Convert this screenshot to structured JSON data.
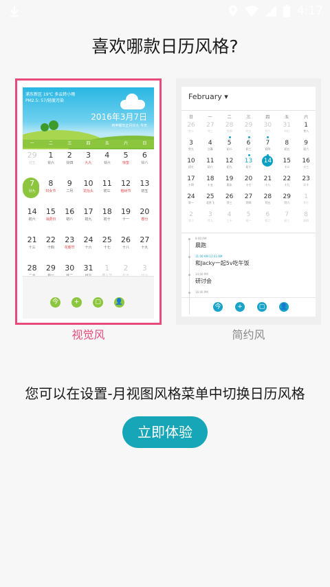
{
  "status_bar": {
    "time": "4:17"
  },
  "title": "喜欢哪款日历风格?",
  "visual_preview": {
    "weather_line1": "浦东新区 19℃ 多云转小雨",
    "weather_line2": "PM2.5: 57/轻度污染",
    "date": "2016年3月7日",
    "sub": "丙申猴年正月廿九 今天",
    "weekdays": [
      "一",
      "二",
      "三",
      "四",
      "五",
      "六",
      "日"
    ],
    "rows": [
      [
        {
          "n": "29",
          "l": "廿五",
          "dim": true
        },
        {
          "n": "1",
          "l": "廿六"
        },
        {
          "n": "2",
          "l": "廿四"
        },
        {
          "n": "3",
          "l": "九九",
          "red": true
        },
        {
          "n": "4",
          "l": "廿六"
        },
        {
          "n": "5",
          "l": "惊蛰",
          "red": true
        },
        {
          "n": "6",
          "l": "廿八"
        }
      ],
      [
        {
          "n": "7",
          "l": "廿九",
          "today": true
        },
        {
          "n": "8",
          "l": "妇女节",
          "red": true
        },
        {
          "n": "9",
          "l": "二月"
        },
        {
          "n": "10",
          "l": "龙抬头",
          "red": true
        },
        {
          "n": "11",
          "l": "初三"
        },
        {
          "n": "12",
          "l": "植树节",
          "red": true
        },
        {
          "n": "13",
          "l": "初五"
        }
      ],
      [
        {
          "n": "14",
          "l": "初六"
        },
        {
          "n": "15",
          "l": "消费日",
          "red": true
        },
        {
          "n": "16",
          "l": "初八"
        },
        {
          "n": "17",
          "l": "初九"
        },
        {
          "n": "18",
          "l": "初十"
        },
        {
          "n": "19",
          "l": "十一"
        },
        {
          "n": "20",
          "l": "春分",
          "red": true
        }
      ],
      [
        {
          "n": "21",
          "l": "十三"
        },
        {
          "n": "22",
          "l": "十四"
        },
        {
          "n": "23",
          "l": "花朝节",
          "red": true
        },
        {
          "n": "24",
          "l": "十六"
        },
        {
          "n": "25",
          "l": "十七"
        },
        {
          "n": "26",
          "l": "十八"
        },
        {
          "n": "27",
          "l": "十九"
        }
      ],
      [
        {
          "n": "28",
          "l": "二十"
        },
        {
          "n": "29",
          "l": "廿一"
        },
        {
          "n": "30",
          "l": "廿二"
        },
        {
          "n": "31",
          "l": "廿三"
        },
        {
          "n": "1",
          "l": "愚人节",
          "dim": true
        },
        {
          "n": "2",
          "l": "廿五",
          "dim": true
        },
        {
          "n": "3",
          "l": "廿六",
          "dim": true
        }
      ]
    ],
    "buttons": [
      "今",
      "+",
      "▢",
      "👤"
    ]
  },
  "simple_preview": {
    "month": "February ▾",
    "weekdays": [
      "日",
      "一",
      "二",
      "三",
      "四",
      "五",
      "六"
    ],
    "rows": [
      [
        {
          "n": "26",
          "l": "廿二",
          "dim": true
        },
        {
          "n": "27",
          "l": "廿三",
          "dim": true
        },
        {
          "n": "28",
          "l": "廿四",
          "dim": true
        },
        {
          "n": "29",
          "l": "廿五",
          "dim": true
        },
        {
          "n": "30",
          "l": "廿六",
          "dim": true
        },
        {
          "n": "31",
          "l": "廿七",
          "dim": true
        },
        {
          "n": "1",
          "l": "廿八"
        }
      ],
      [
        {
          "n": "3",
          "l": "廿九"
        },
        {
          "n": "4",
          "l": "立春"
        },
        {
          "n": "5",
          "l": "初二",
          "dot": true
        },
        {
          "n": "6",
          "l": "初三",
          "dot": true
        },
        {
          "n": "7",
          "l": "初四",
          "dot": true
        },
        {
          "n": "8",
          "l": "初五"
        },
        {
          "n": "9",
          "l": "初六"
        }
      ],
      [
        {
          "n": "10",
          "l": "初七"
        },
        {
          "n": "11",
          "l": "初八"
        },
        {
          "n": "12",
          "l": "初九"
        },
        {
          "n": "13",
          "l": "初十",
          "blue": true,
          "dot": true
        },
        {
          "n": "14",
          "l": "",
          "today": true,
          "dot": true
        },
        {
          "n": "15",
          "l": "十二"
        },
        {
          "n": "16",
          "l": "十三"
        }
      ],
      [
        {
          "n": "17",
          "l": "十四"
        },
        {
          "n": "18",
          "l": "十五"
        },
        {
          "n": "19",
          "l": "雨水"
        },
        {
          "n": "20",
          "l": "十七"
        },
        {
          "n": "21",
          "l": "十八"
        },
        {
          "n": "22",
          "l": "十九"
        },
        {
          "n": "23",
          "l": "二十"
        }
      ],
      [
        {
          "n": "24",
          "l": "廿一"
        },
        {
          "n": "25",
          "l": "北京飞"
        },
        {
          "n": "26",
          "l": "廿三"
        },
        {
          "n": "27",
          "l": "廿四"
        },
        {
          "n": "28",
          "l": "廿五"
        },
        {
          "n": "29",
          "l": "廿六"
        },
        {
          "n": "1",
          "l": "廿七",
          "dim": true
        }
      ],
      [
        {
          "n": "2",
          "l": "廿八",
          "dim": true
        },
        {
          "n": "3",
          "l": "廿九",
          "dim": true
        },
        {
          "n": "4",
          "l": "三十",
          "dim": true
        },
        {
          "n": "5",
          "l": "初一",
          "dim": true
        },
        {
          "n": "6",
          "l": "初二",
          "dim": true
        },
        {
          "n": "7",
          "l": "初三",
          "dim": true
        },
        {
          "n": "8",
          "l": "初四",
          "dim": true
        }
      ]
    ],
    "events": [
      {
        "time": "8:00 AM",
        "desc": "晨跑",
        "blue": false
      },
      {
        "time": "11:00 AM-12:03 AM",
        "desc": "和Jacky一起5v吃午饭",
        "blue": true
      },
      {
        "time": "14:00 PM",
        "desc": "研讨会",
        "blue": false
      },
      {
        "time": "16:00 PM",
        "desc": "",
        "blue": false
      }
    ],
    "buttons": [
      "今",
      "+",
      "▢",
      "👤"
    ]
  },
  "labels": {
    "visual": "视觉风",
    "simple": "简约风"
  },
  "hint": "您可以在设置-月视图风格菜单中切换日历风格",
  "cta": "立即体验",
  "colors": {
    "accent_pink": "#e84a7c",
    "cta_teal": "#17a6b7",
    "visual_green": "#8cc63f",
    "simple_blue": "#19a3c8"
  }
}
